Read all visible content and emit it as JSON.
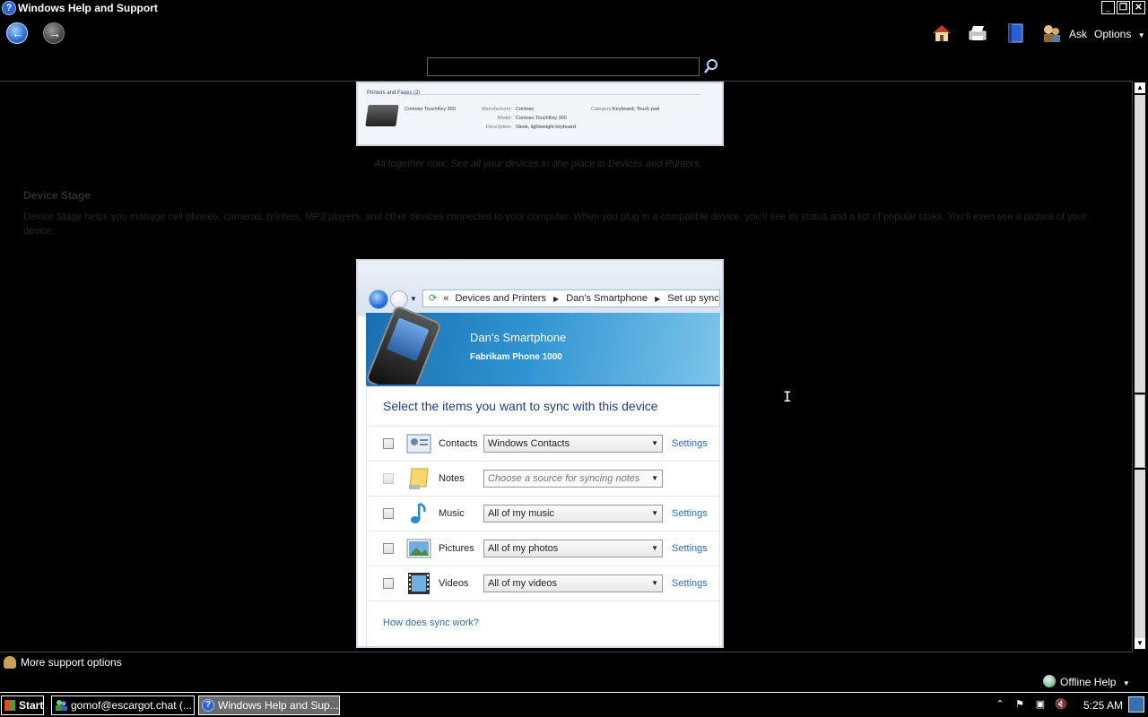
{
  "window": {
    "title": "Windows Help and Support",
    "controls": {
      "minimize": "_",
      "restore": "❐",
      "close": "✕"
    }
  },
  "toolbar": {
    "ask_label": "Ask",
    "options_label": "Options",
    "icons": [
      "back-icon",
      "forward-icon",
      "home-icon",
      "print-icon",
      "browse-help-icon",
      "ask-icon"
    ]
  },
  "search": {
    "value": "",
    "placeholder": ""
  },
  "content": {
    "shot1": {
      "group_header": "Printers and Faxes (2)",
      "device_name": "Contoso TouchKey 300",
      "manufacturer_label": "Manufacturer:",
      "manufacturer_value": "Contoso",
      "model_label": "Model:",
      "model_value": "Contoso TouchKey 300",
      "description_label": "Description:",
      "description_value": "Sleek, lightweight keyboard",
      "category_label": "Category:",
      "category_value": "Keyboard; Touch pad",
      "caption": "All together now: See all your devices in one place in Devices and Printers."
    },
    "section_heading": "Device Stage",
    "section_body": "Device Stage helps you manage cell phones, cameras, printers, MP3 players, and other devices connected to your computer. When you plug in a compatible device, you'll see its status and a list of popular tasks. You'll even see a picture of your device.",
    "shot2": {
      "breadcrumb": [
        "Devices and Printers",
        "Dan's Smartphone",
        "Set up sync"
      ],
      "device_name": "Dan's Smartphone",
      "device_model": "Fabrikam Phone 1000",
      "sync_title": "Select the items you want to sync with this device",
      "rows": [
        {
          "label": "Contacts",
          "select": "Windows Contacts",
          "settings": "Settings",
          "enabled": true
        },
        {
          "label": "Notes",
          "select": "Choose a source for syncing notes",
          "settings": "",
          "enabled": false
        },
        {
          "label": "Music",
          "select": "All of my music",
          "settings": "Settings",
          "enabled": true
        },
        {
          "label": "Pictures",
          "select": "All of my photos",
          "settings": "Settings",
          "enabled": true
        },
        {
          "label": "Videos",
          "select": "All of my videos",
          "settings": "Settings",
          "enabled": true
        }
      ],
      "how_link": "How does sync work?"
    }
  },
  "footer": {
    "more_support": "More support options",
    "offline_help": "Offline Help"
  },
  "taskbar": {
    "start_label": "Start",
    "tasks": [
      {
        "label": "gomof@escargot.chat (...",
        "active": false
      },
      {
        "label": "Windows Help and Sup...",
        "active": true
      }
    ],
    "clock": "5:25 AM"
  },
  "colors": {
    "background": "#000000",
    "link": "#2a6cc0",
    "banner": "#2f93d2",
    "sync_title": "#1e3e8a"
  }
}
